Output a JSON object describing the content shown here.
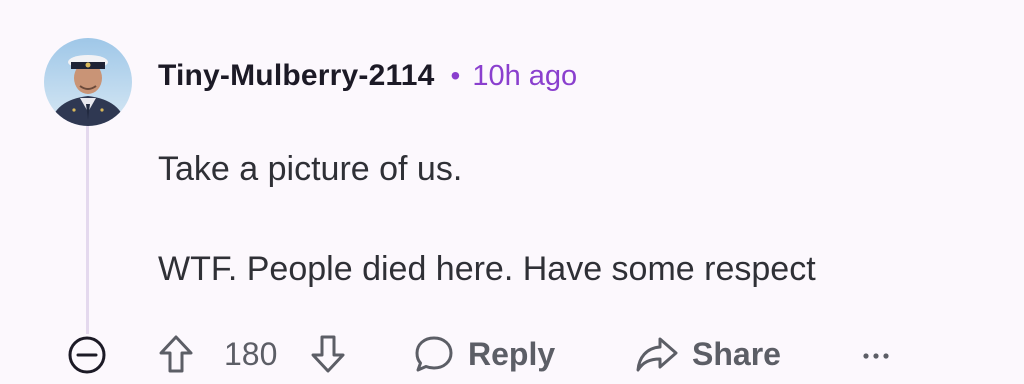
{
  "comment": {
    "author": "Tiny-Mulberry-2114",
    "separator": "•",
    "timestamp": "10h ago",
    "lines": [
      "Take a picture of us.",
      "WTF. People died here. Have some respect"
    ]
  },
  "actions": {
    "score": "180",
    "reply_label": "Reply",
    "share_label": "Share",
    "more_label": "···"
  },
  "icons": {
    "avatar": "avatar-officer",
    "collapse": "collapse-minus-icon",
    "upvote": "upvote-arrow-icon",
    "downvote": "downvote-arrow-icon",
    "reply": "speech-bubble-icon",
    "share": "share-arrow-icon",
    "more": "ellipsis-icon"
  },
  "colors": {
    "background": "#fcf8fd",
    "accent": "#8a3fce",
    "thread_line": "#e4d9ee",
    "muted_text": "#5c5e66"
  }
}
